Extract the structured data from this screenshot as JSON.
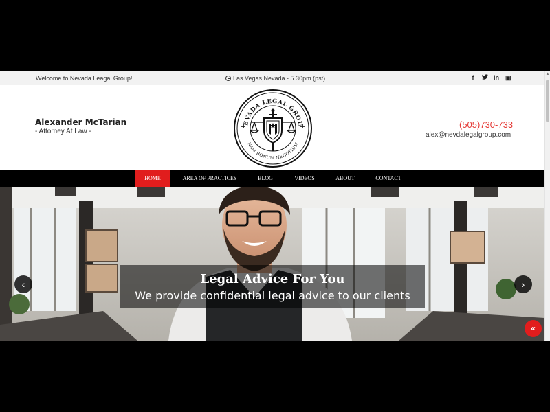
{
  "topbar": {
    "welcome": "Welcome to Nevada Leagal Group!",
    "location": "Las Vegas,Nevada - 5.30pm (pst)",
    "socials": [
      {
        "name": "facebook-icon",
        "glyph": "f"
      },
      {
        "name": "twitter-icon",
        "glyph": "t"
      },
      {
        "name": "linkedin-icon",
        "glyph": "in"
      },
      {
        "name": "youtube-icon",
        "glyph": "▣"
      }
    ]
  },
  "header": {
    "name": "Alexander McTarian",
    "role": "- Attorney At Law -",
    "phone": "(505)730-733",
    "email": "alex@nevdalegalgroup.com",
    "logo": {
      "top_text": "NEVADA LEGAL GROUP",
      "bottom_text": "NAM BONUM NEGOTIUM"
    }
  },
  "nav": {
    "items": [
      "HOME",
      "AREA OF PRACTICES",
      "BLOG",
      "VIDEOS",
      "ABOUT",
      "CONTACT"
    ],
    "active": "HOME"
  },
  "hero": {
    "title": "Legal Advice For You",
    "subtitle": "We provide confidential legal advice to our clients",
    "prev_icon": "chevron-left-icon",
    "next_icon": "chevron-right-icon"
  },
  "back_to_top_icon": "double-chevron-up-icon",
  "colors": {
    "accent": "#e11d1d",
    "phone": "#e53935",
    "nav_bg": "#000000",
    "topbar_bg": "#f2f2f2"
  }
}
